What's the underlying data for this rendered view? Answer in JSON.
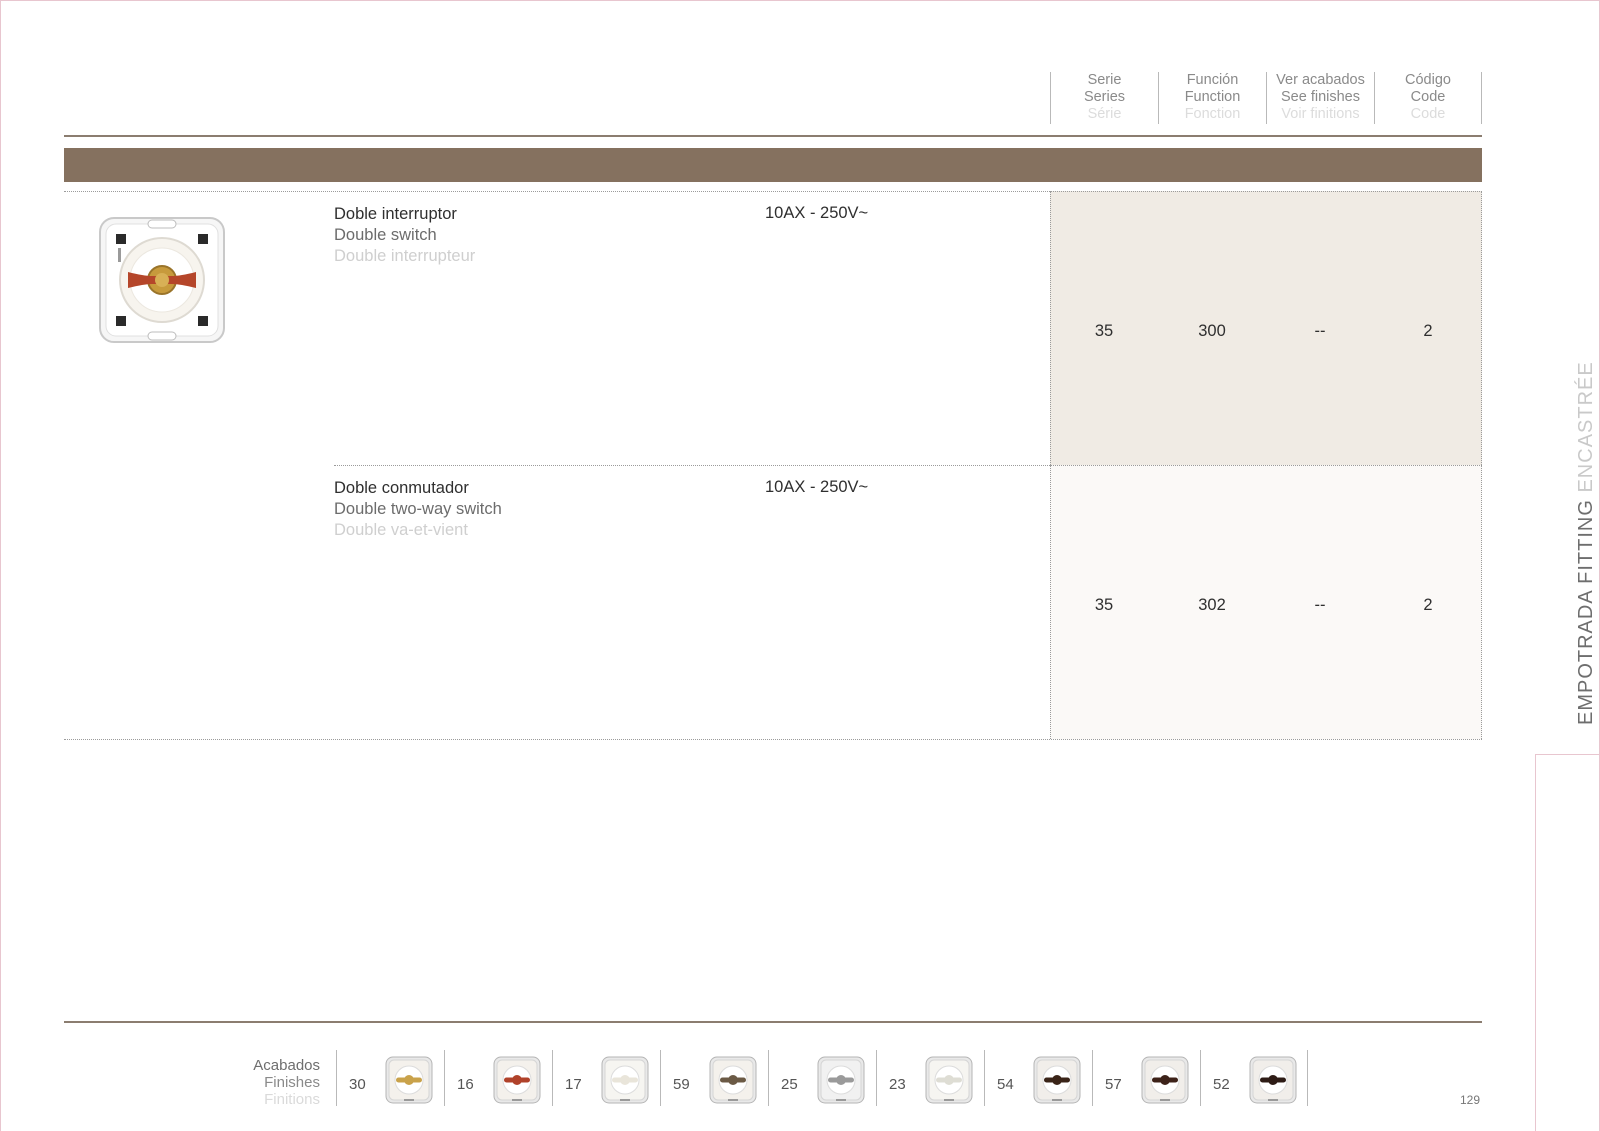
{
  "header": {
    "columns": [
      {
        "es": "Serie",
        "en": "Series",
        "fr": "Série"
      },
      {
        "es": "Función",
        "en": "Function",
        "fr": "Fonction"
      },
      {
        "es": "Ver acabados",
        "en": "See finishes",
        "fr": "Voir finitions"
      },
      {
        "es": "Código",
        "en": "Code",
        "fr": "Code"
      }
    ]
  },
  "products": [
    {
      "es": "Doble interruptor",
      "en": "Double switch",
      "fr": "Double interrupteur",
      "rating": "10AX - 250V~",
      "serie": "35",
      "function": "300",
      "finishes": "--",
      "code": "2"
    },
    {
      "es": "Doble conmutador",
      "en": "Double two-way switch",
      "fr": "Double va-et-vient",
      "rating": "10AX - 250V~",
      "serie": "35",
      "function": "302",
      "finishes": "--",
      "code": "2"
    }
  ],
  "finishes": {
    "label": {
      "es": "Acabados",
      "en": "Finishes",
      "fr": "Finitions"
    },
    "items": [
      {
        "code": "30",
        "plate": "#f4f1ec",
        "knob": "#c9a24a"
      },
      {
        "code": "16",
        "plate": "#f4f1ec",
        "knob": "#b0422a"
      },
      {
        "code": "17",
        "plate": "#f6f5f1",
        "knob": "#e9e5da"
      },
      {
        "code": "59",
        "plate": "#f4f1ec",
        "knob": "#6b5a45"
      },
      {
        "code": "25",
        "plate": "#f1f1f1",
        "knob": "#9a9a9a"
      },
      {
        "code": "23",
        "plate": "#f6f5f1",
        "knob": "#deddd4"
      },
      {
        "code": "54",
        "plate": "#f1eeea",
        "knob": "#3a2418"
      },
      {
        "code": "57",
        "plate": "#f1eeea",
        "knob": "#3d2219"
      },
      {
        "code": "52",
        "plate": "#f1eeea",
        "knob": "#2e1c16"
      }
    ]
  },
  "page_number": "129",
  "side_tab": {
    "strong": "EMPOTRADA FITTING",
    "light": " ENCASTRÉE"
  },
  "colors": {
    "accent": "#85715f",
    "row1_bg": "#f0ebe4",
    "row2_bg": "#fbf9f7"
  }
}
